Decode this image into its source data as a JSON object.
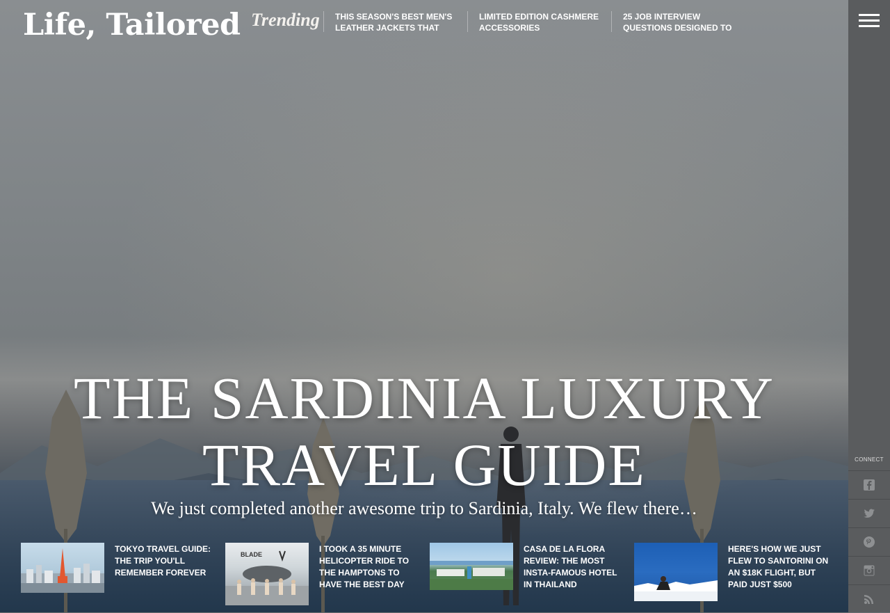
{
  "header": {
    "logo": "Life, Tailored",
    "trending_label": "Trending",
    "trending": [
      "THIS SEASON'S BEST MEN'S LEATHER JACKETS THAT",
      "LIMITED EDITION CASHMERE ACCESSORIES",
      "25 JOB INTERVIEW QUESTIONS DESIGNED TO"
    ]
  },
  "hero": {
    "title_line1": "THE SARDINIA LUXURY",
    "title_line2": "TRAVEL GUIDE",
    "excerpt": "We just completed another awesome trip to Sardinia, Italy. We flew there…"
  },
  "sidebar": {
    "connect_label": "CONNECT",
    "social_icons": [
      "facebook-icon",
      "twitter-icon",
      "pinterest-icon",
      "instagram-icon",
      "rss-icon"
    ]
  },
  "cards": [
    {
      "title": "TOKYO TRAVEL GUIDE: THE TRIP YOU'LL REMEMBER FOREVER",
      "thumb": "tokyo-skyline"
    },
    {
      "title": "I TOOK A 35 MINUTE HELICOPTER RIDE TO THE HAMPTONS TO HAVE THE BEST DAY",
      "thumb": "helicopter",
      "thumb_text": "BLADE"
    },
    {
      "title": "CASA DE LA FLORA REVIEW: THE MOST INSTA-FAMOUS HOTEL IN THAILAND",
      "thumb": "hotel-pool"
    },
    {
      "title": "HERE'S HOW WE JUST FLEW TO SANTORINI ON AN $18K FLIGHT, BUT PAID JUST $500",
      "thumb": "santorini"
    }
  ],
  "colors": {
    "sidebar": "#5a5c5e",
    "text": "#ffffff"
  }
}
